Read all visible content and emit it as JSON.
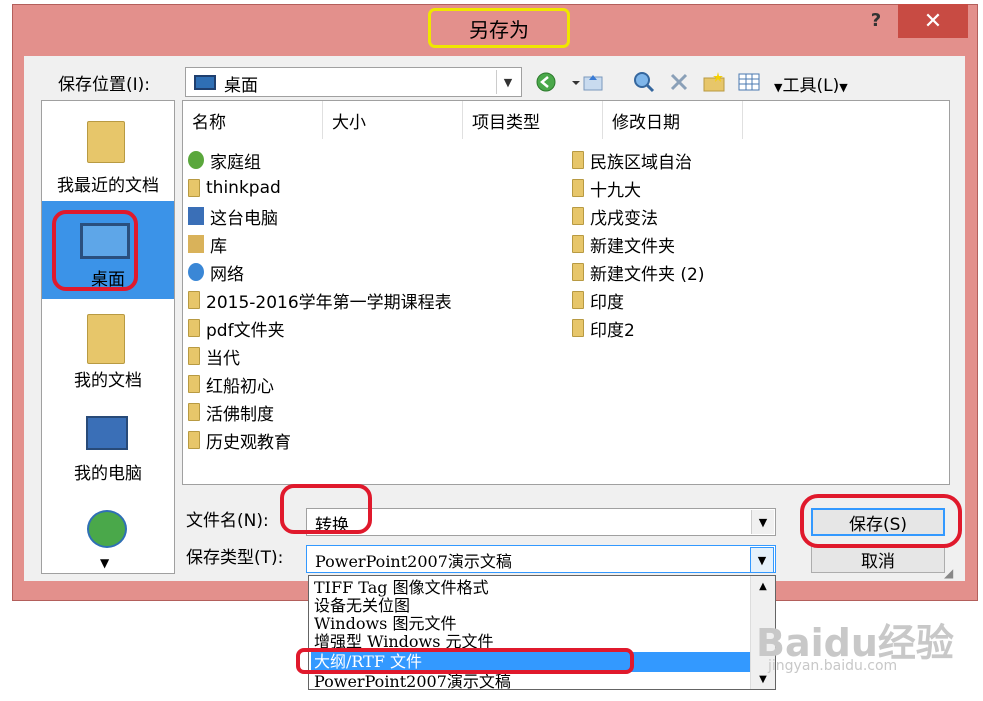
{
  "window": {
    "title": "另存为",
    "help": "?",
    "close": "✕"
  },
  "location": {
    "label": "保存位置(I):",
    "value": "桌面",
    "tools": "工具(L)"
  },
  "places": [
    "我最近的文档",
    "桌面",
    "我的文档",
    "我的电脑"
  ],
  "columns": [
    "名称",
    "大小",
    "项目类型",
    "修改日期"
  ],
  "items_left": [
    "家庭组",
    "thinkpad",
    "这台电脑",
    "库",
    "网络",
    "2015-2016学年第一学期课程表",
    "pdf文件夹",
    "当代",
    "红船初心",
    "活佛制度",
    "历史观教育"
  ],
  "items_right": [
    "民族区域自治",
    "十九大",
    "戊戌变法",
    "新建文件夹",
    "新建文件夹 (2)",
    "印度",
    "印度2"
  ],
  "filename": {
    "label": "文件名(N):",
    "value": "转换"
  },
  "filetype": {
    "label": "保存类型(T):",
    "value": "PowerPoint2007演示文稿"
  },
  "buttons": {
    "save": "保存(S)",
    "cancel": "取消"
  },
  "type_options": [
    "TIFF Tag 图像文件格式",
    "设备无关位图",
    "Windows 图元文件",
    "增强型 Windows 元文件",
    "大纲/RTF 文件",
    "PowerPoint2007演示文稿"
  ],
  "selected_option": "大纲/RTF 文件",
  "watermark": {
    "brand": "Baidu经验",
    "url": "jingyan.baidu.com"
  },
  "colors": {
    "frame": "#e3908c",
    "close": "#c84b43",
    "highlight": "#3399ff",
    "annotation": "#e0192c",
    "title_annotation": "#f0e600"
  }
}
